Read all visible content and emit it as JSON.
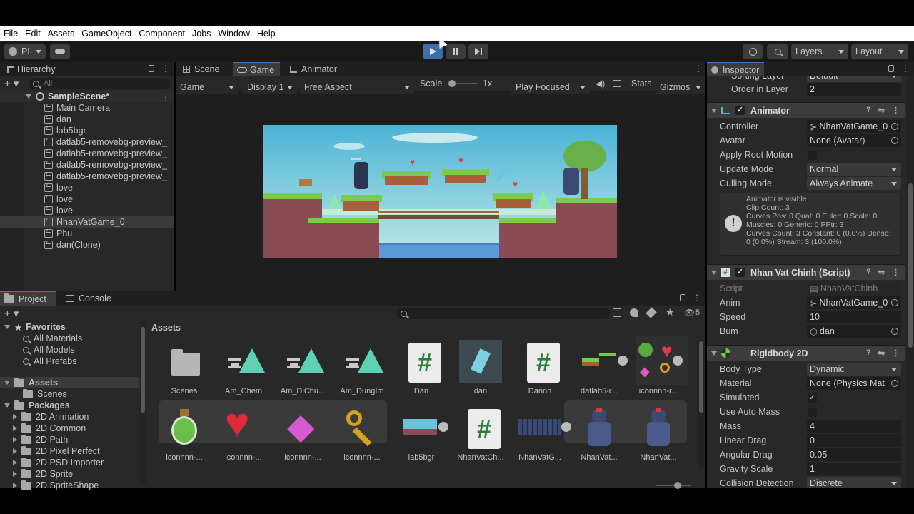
{
  "menu": [
    "File",
    "Edit",
    "Assets",
    "GameObject",
    "Component",
    "Jobs",
    "Window",
    "Help"
  ],
  "toolbar": {
    "account": "PL",
    "layers": "Layers",
    "layout": "Layout"
  },
  "hierarchy": {
    "tab": "Hierarchy",
    "search_placeholder": "All",
    "scene": "SampleScene*",
    "items": [
      "Main Camera",
      "dan",
      "lab5bgr",
      "datlab5-removebg-preview_",
      "datlab5-removebg-preview_",
      "datlab5-removebg-preview_",
      "datlab5-removebg-preview_",
      "love",
      "love",
      "love",
      "NhanVatGame_0",
      "Phu",
      "dan(Clone)"
    ],
    "selected_index": 10
  },
  "game_view": {
    "tabs": [
      "Scene",
      "Game",
      "Animator"
    ],
    "active_tab": "Game",
    "display_mode": "Game",
    "display": "Display 1",
    "aspect": "Free Aspect",
    "scale_label": "Scale",
    "scale_value": "1x",
    "play_mode": "Play Focused",
    "stats": "Stats",
    "gizmos": "Gizmos"
  },
  "project": {
    "tabs": [
      "Project",
      "Console"
    ],
    "hidden_count": "5",
    "favorites_label": "Favorites",
    "favorites": [
      "All Materials",
      "All Models",
      "All Prefabs"
    ],
    "assets_label": "Assets",
    "assets_children": [
      "Scenes"
    ],
    "packages_label": "Packages",
    "packages": [
      "2D Animation",
      "2D Common",
      "2D Path",
      "2D Pixel Perfect",
      "2D PSD Importer",
      "2D Sprite",
      "2D SpriteShape"
    ],
    "breadcrumb": "Assets",
    "row1": [
      "Scenes",
      "Am_Chem",
      "Am_DiChu...",
      "Am_DungIm",
      "Dan",
      "dan",
      "Dannn",
      "datlab5-r...",
      "iconnnn-r..."
    ],
    "row2": [
      "iconnnn-...",
      "iconnnn-...",
      "iconnnn-...",
      "iconnnn-...",
      "lab5bgr",
      "NhanVatCh...",
      "NhanVatG...",
      "NhanVat...",
      "NhanVat..."
    ]
  },
  "inspector": {
    "tab": "Inspector",
    "sorting_layer_label": "Sorting Layer",
    "sorting_layer_value": "Default",
    "order_label": "Order in Layer",
    "order_value": "2",
    "animator": {
      "title": "Animator",
      "controller_label": "Controller",
      "controller_value": "NhanVatGame_0",
      "avatar_label": "Avatar",
      "avatar_value": "None (Avatar)",
      "root_motion_label": "Apply Root Motion",
      "update_mode_label": "Update Mode",
      "update_mode_value": "Normal",
      "culling_label": "Culling Mode",
      "culling_value": "Always Animate",
      "info": [
        "Animator is visible",
        "Clip Count: 3",
        "Curves Pos: 0 Quat: 0 Euler: 0 Scale: 0",
        "Muscles: 0 Generic: 0 PPtr: 3",
        "Curves Count: 3 Constant: 0 (0.0%) Dense:",
        "0 (0.0%) Stream: 3 (100.0%)"
      ]
    },
    "script_comp": {
      "title": "Nhan Vat Chinh (Script)",
      "script_label": "Script",
      "script_value": "NhanVatChinh",
      "anim_label": "Anim",
      "anim_value": "NhanVatGame_0",
      "speed_label": "Speed",
      "speed_value": "10",
      "bum_label": "Bum",
      "bum_value": "dan"
    },
    "rigidbody": {
      "title": "Rigidbody 2D",
      "body_type_label": "Body Type",
      "body_type_value": "Dynamic",
      "material_label": "Material",
      "material_value": "None (Physics Mat",
      "simulated_label": "Simulated",
      "auto_mass_label": "Use Auto Mass",
      "mass_label": "Mass",
      "mass_value": "4",
      "linear_drag_label": "Linear Drag",
      "linear_drag_value": "0",
      "angular_drag_label": "Angular Drag",
      "angular_drag_value": "0.05",
      "gravity_label": "Gravity Scale",
      "gravity_value": "1",
      "collision_label": "Collision Detection",
      "collision_value": "Discrete"
    }
  },
  "colors": {
    "accent": "#3a79bb",
    "play_active": "#3d6fad",
    "panel": "#282828",
    "field": "#1e1e1e"
  }
}
